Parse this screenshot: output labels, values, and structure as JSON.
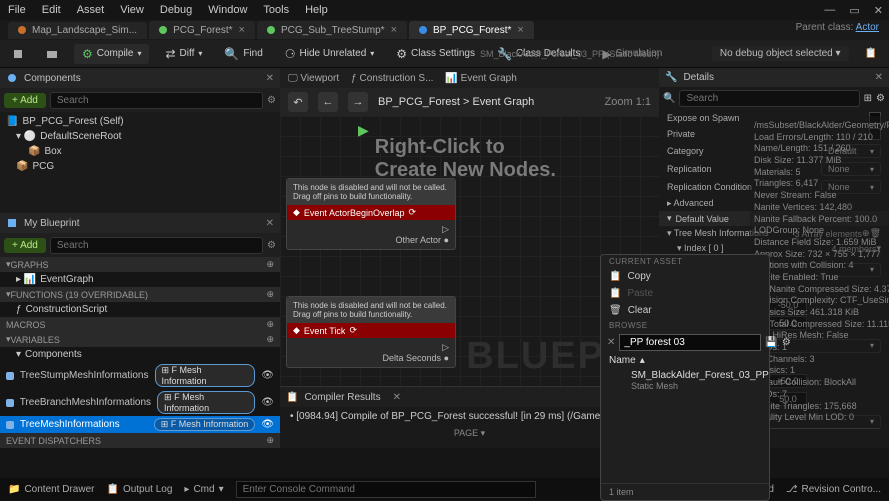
{
  "menu": [
    "File",
    "Edit",
    "Asset",
    "View",
    "Debug",
    "Window",
    "Tools",
    "Help"
  ],
  "parent_class": {
    "label": "Parent class:",
    "value": "Actor"
  },
  "tabs": [
    {
      "label": "Map_Landscape_Sim...",
      "active": false
    },
    {
      "label": "PCG_Forest*",
      "active": false
    },
    {
      "label": "PCG_Sub_TreeStump*",
      "active": false
    },
    {
      "label": "BP_PCG_Forest*",
      "active": true
    }
  ],
  "toolbar": {
    "compile": "Compile",
    "diff": "Diff",
    "find": "Find",
    "hide": "Hide Unrelated",
    "class_settings": "Class Settings",
    "class_defaults": "Class Defaults",
    "simulation": "Simulation",
    "debug_dropdown": "No debug object selected"
  },
  "header_overlay": "SM_BlackAlder_Forest_03_PP (Static Mesh)",
  "components_panel": {
    "title": "Components",
    "add": "Add",
    "search_ph": "Search",
    "items": [
      {
        "label": "BP_PCG_Forest (Self)",
        "indent": 0
      },
      {
        "label": "DefaultSceneRoot",
        "indent": 1
      },
      {
        "label": "Box",
        "indent": 2
      },
      {
        "label": "PCG",
        "indent": 1
      }
    ]
  },
  "myblueprint": {
    "title": "My Blueprint",
    "add": "Add",
    "search_ph": "Search",
    "sections": {
      "graphs": "GRAPHS",
      "event_graph": "EventGraph",
      "functions": "FUNCTIONS (19 OVERRIDABLE)",
      "construction": "ConstructionScript",
      "macros": "MACROS",
      "variables": "VARIABLES",
      "components": "Components",
      "event_dispatchers": "EVENT DISPATCHERS"
    },
    "vars": [
      {
        "name": "TreeStumpMeshInformations",
        "type": "F Mesh Information",
        "selected": false
      },
      {
        "name": "TreeBranchMeshInformations",
        "type": "F Mesh Information",
        "selected": false
      },
      {
        "name": "TreeMeshInformations",
        "type": "F Mesh Information",
        "selected": true
      }
    ]
  },
  "center": {
    "viewport": "Viewport",
    "construction": "Construction S...",
    "event_graph": "Event Graph",
    "breadcrumb_prefix": "BP_PCG_Forest",
    "breadcrumb": "Event Graph",
    "zoom": "Zoom 1:1",
    "hint": "Right-Click to Create New Nodes.",
    "watermark": "BLUEPRI",
    "node1_comment": "This node is disabled and will not be called.\nDrag off pins to build functionality.",
    "node1_title": "Event ActorBeginOverlap",
    "node1_pin": "Other Actor",
    "node2_comment": "This node is disabled and will not be called.\nDrag off pins to build functionality.",
    "node2_title": "Event Tick",
    "node2_pin": "Delta Seconds"
  },
  "asset_stats": [
    "/msSubset/BlackAlder/Geometry/PivotPai...",
    "Triangles: 6,417",
    "Never Stream: False",
    "Nanite Vertices: 142,480",
    "Nanite Fallback Percent: 100.0",
    "LODGroup: None",
    "Distance Field Size: 1.659 MiB",
    "Approx Size: 732 × 755 × 1,777",
    "Sections with Collision: 4",
    "Nanite Enabled: True",
    "Est Nanite Compressed Size: 4.374 MiB",
    "Collision Complexity: CTF_UseSimpleAndComplex",
    "Physics Size: 461.318 KiB",
    "Est Total Compressed Size: 11.115 MiB",
    "Has HiRes Mesh: False",
    "LODs: 1",
    "UVChannels: 3",
    "Physics: 1",
    "Default Collision: BlockAll",
    "LODs: 7",
    "Nanite Triangles: 175,668",
    "Quality Level Min LOD: 0"
  ],
  "stats_top": [
    "Load Errors/Length: 110 / 210",
    "Name/Length: 151 / 260",
    "Disk Size: 11.377 MiB",
    "Materials: 5"
  ],
  "context_menu": {
    "section1": "CURRENT ASSET",
    "copy": "Copy",
    "paste": "Paste",
    "clear": "Clear",
    "section2": "BROWSE",
    "search_value": "_PP forest 03",
    "name_header": "Name",
    "result_title": "SM_BlackAlder_Forest_03_PP",
    "result_sub": "Static Mesh",
    "footer": "1 item"
  },
  "details": {
    "title": "Details",
    "search_ph": "Search",
    "rows": {
      "expose": "Expose on Spawn",
      "private": "Private",
      "category": "Category",
      "replication": "Replication",
      "rep_cond": "Replication Condition",
      "advanced": "Advanced"
    },
    "vals": {
      "category": "Default",
      "replication": "None",
      "rep_cond": "None"
    },
    "default_value": "Default Value",
    "tree_mesh": "Tree Mesh Informations",
    "array_count": "3 Array elements",
    "index": "Index [ 0 ]",
    "members": "4 members",
    "none": "None",
    "nums": [
      "-50.0",
      "-50.0",
      "-50.0",
      "50.0",
      "50.0",
      "50.0"
    ]
  },
  "compiler": {
    "title": "Compiler Results",
    "msg": "[0984.94] Compile of BP_PCG_Forest successful! [in 29 ms] (/Game/Bluep...",
    "page": "PAGE"
  },
  "statusbar": {
    "content_drawer": "Content Drawer",
    "output_log": "Output Log",
    "cmd": "Cmd",
    "cmd_ph": "Enter Console Command",
    "unsaved": "4 unsaved",
    "revision": "Revision Contro..."
  }
}
